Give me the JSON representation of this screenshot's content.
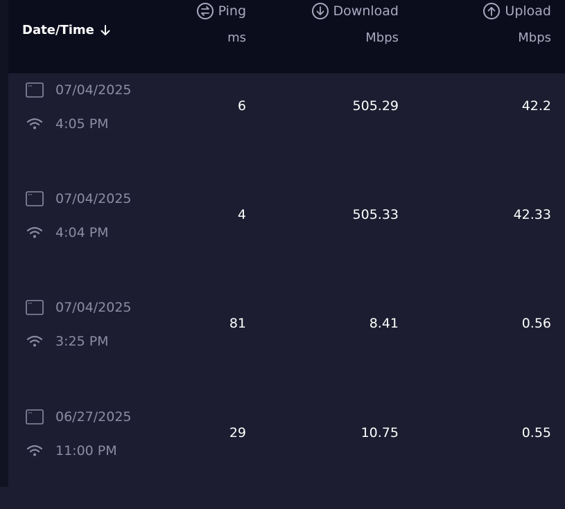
{
  "header": {
    "date_time_label": "Date/Time",
    "ping_label": "Ping",
    "ping_unit": "ms",
    "download_label": "Download",
    "download_unit": "Mbps",
    "upload_label": "Upload",
    "upload_unit": "Mbps",
    "sort_icon": "arrow-down-icon",
    "ping_icon": "ping-icon",
    "download_icon": "download-icon",
    "upload_icon": "upload-icon"
  },
  "rows": [
    {
      "date": "07/04/2025",
      "time": "4:05 PM",
      "ping": "6",
      "download": "505.29",
      "upload": "42.2"
    },
    {
      "date": "07/04/2025",
      "time": "4:04 PM",
      "ping": "4",
      "download": "505.33",
      "upload": "42.33"
    },
    {
      "date": "07/04/2025",
      "time": "3:25 PM",
      "ping": "81",
      "download": "8.41",
      "upload": "0.56"
    },
    {
      "date": "06/27/2025",
      "time": "11:00 PM",
      "ping": "29",
      "download": "10.75",
      "upload": "0.55"
    }
  ],
  "colors": {
    "background": "#1c1d30",
    "header_background": "#0c0d1c",
    "muted_text": "#8c8da3",
    "value_text": "#ffffff"
  }
}
